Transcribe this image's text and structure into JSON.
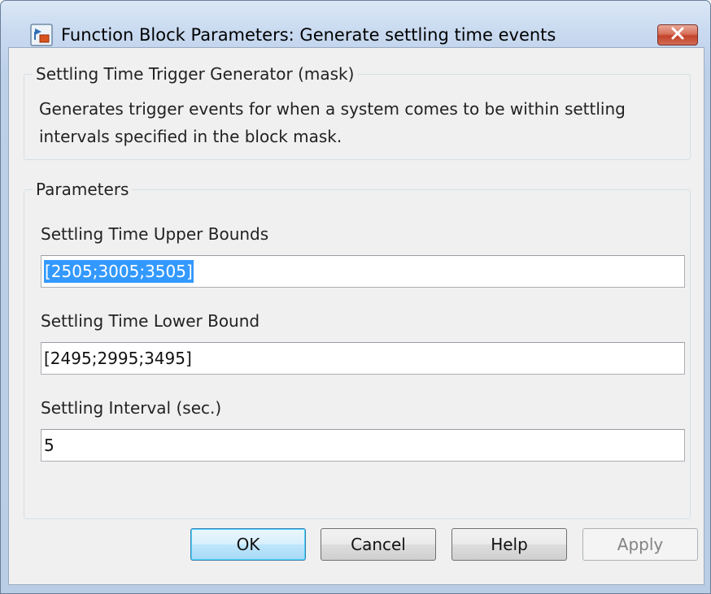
{
  "window": {
    "title": "Function Block Parameters: Generate settling time events",
    "icons": {
      "app": "simulink-block-icon",
      "close": "close-icon"
    }
  },
  "mask": {
    "legend": "Settling Time Trigger Generator (mask)",
    "description": "Generates trigger events for when a system comes to be within settling intervals specified in the block mask."
  },
  "parameters": {
    "legend": "Parameters",
    "upper_bounds": {
      "label": "Settling Time Upper Bounds",
      "value": "[2505;3005;3505]"
    },
    "lower_bound": {
      "label": "Settling Time Lower Bound",
      "value": "[2495;2995;3495]"
    },
    "interval": {
      "label": "Settling Interval (sec.)",
      "value": "5"
    }
  },
  "buttons": {
    "ok": "OK",
    "cancel": "Cancel",
    "help": "Help",
    "apply": "Apply"
  },
  "colors": {
    "selection": "#3399ff",
    "close_button": "#c4422b",
    "default_button_border": "#3c7fb1"
  }
}
